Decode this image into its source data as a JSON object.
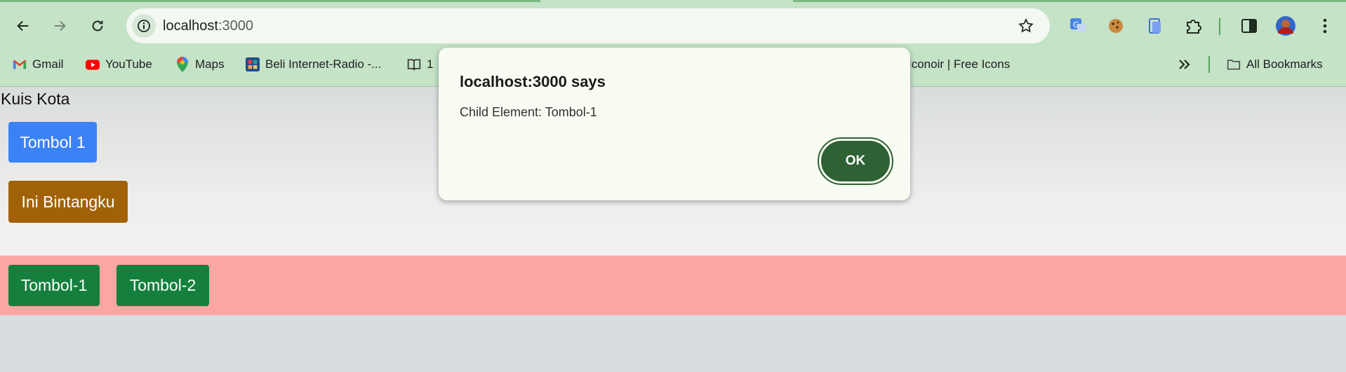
{
  "browser": {
    "url_host": "localhost",
    "url_port": ":3000",
    "bookmarks": [
      {
        "label": "Gmail",
        "icon": "gmail-icon"
      },
      {
        "label": "YouTube",
        "icon": "youtube-icon"
      },
      {
        "label": "Maps",
        "icon": "maps-icon"
      },
      {
        "label": "Beli Internet-Radio -...",
        "icon": "radio-icon"
      },
      {
        "label": "1",
        "icon": "book-icon"
      },
      {
        "label": "Iconoir | Free Icons",
        "icon": ""
      }
    ],
    "all_bookmarks": "All Bookmarks"
  },
  "page": {
    "title": "Kuis Kota",
    "buttons": {
      "tombol1": "Tombol 1",
      "bintang": "Ini Bintangku",
      "tombol_a": "Tombol-1",
      "tombol_b": "Tombol-2"
    }
  },
  "dialog": {
    "title": "localhost:3000 says",
    "message": "Child Element: Tombol-1",
    "ok": "OK"
  },
  "colors": {
    "chrome": "#c5e3c7",
    "blue": "#3b82f6",
    "brown": "#a16207",
    "green": "#15803d",
    "strip": "#fca5a5",
    "dialog_ok": "#2e6133"
  }
}
